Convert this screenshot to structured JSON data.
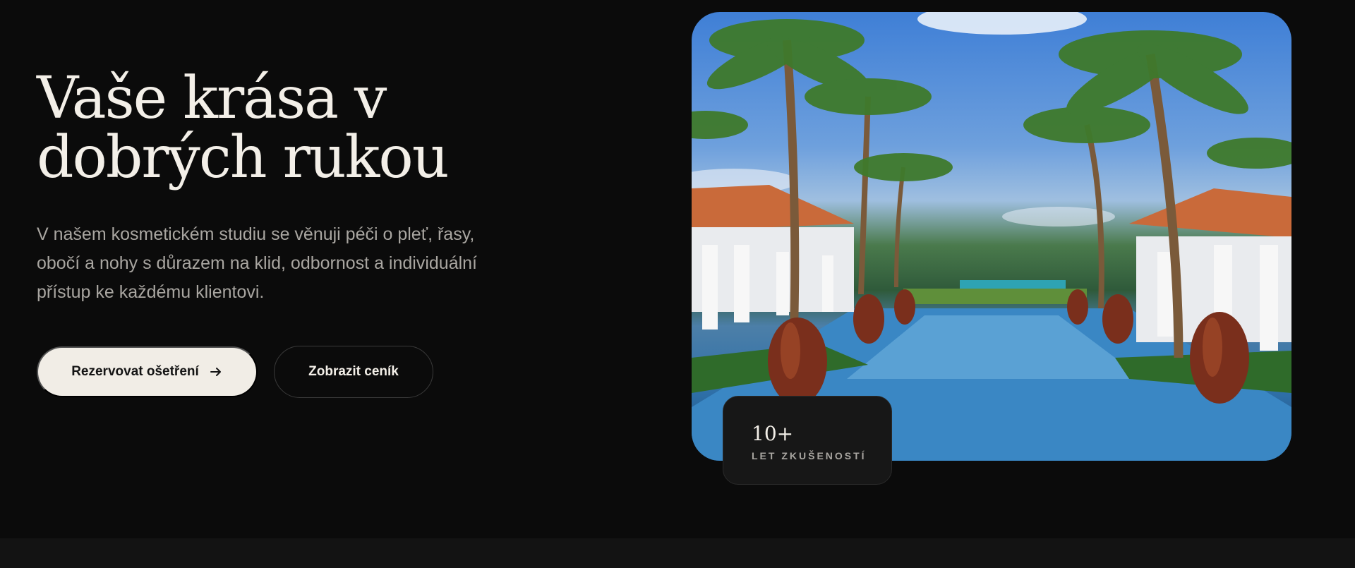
{
  "hero": {
    "headline": "Vaše krása v dobrých rukou",
    "lead": "V našem kosmetickém studiu se věnuji péči o pleť, řasy, obočí a nohy s důrazem na klid, odbornost a individuální přístup ke každému klientovi.",
    "primary_button": "Rezervovat ošetření",
    "secondary_button": "Zobrazit ceník",
    "image_subject": "tropical resort pool with palm trees and clay urns"
  },
  "stat": {
    "value": "10+",
    "label": "LET ZKUŠENOSTÍ"
  },
  "icons": {
    "primary_button_icon": "arrow-right-icon"
  },
  "colors": {
    "background": "#0b0b0b",
    "primary_button_bg": "#f1ede6",
    "text": "#f3efe8",
    "muted_text": "#a9a6a1"
  }
}
